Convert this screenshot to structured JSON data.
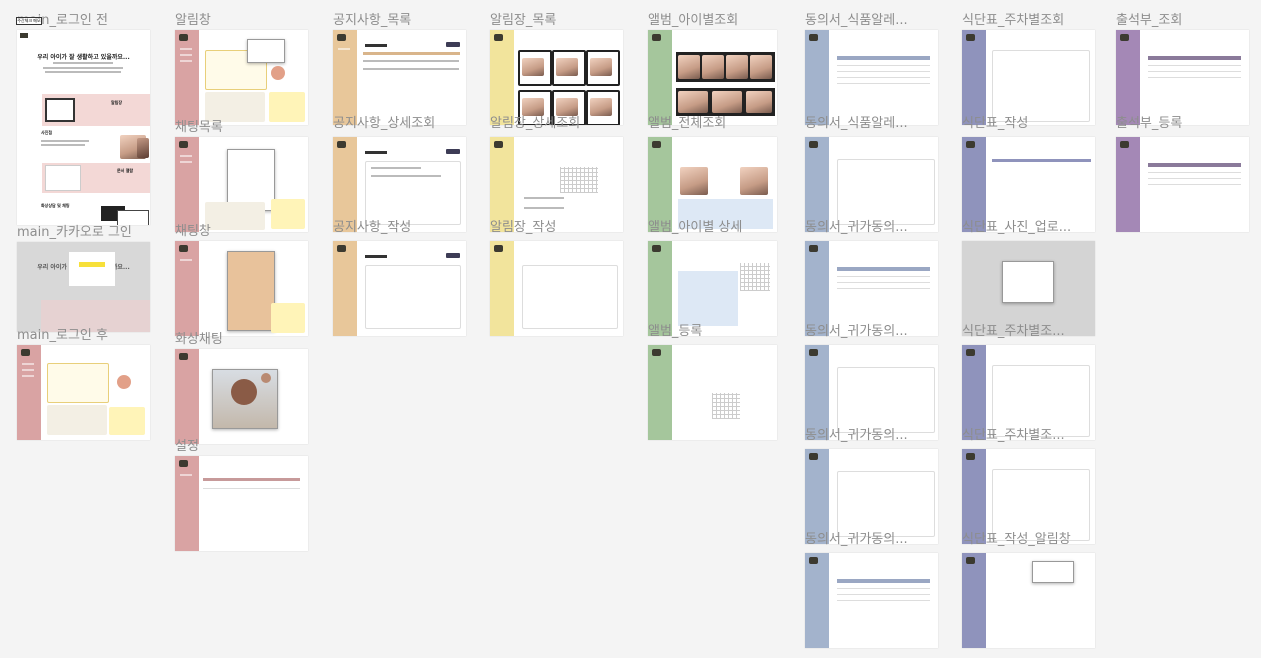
{
  "labels": {
    "c0": [
      "main_로그인 전",
      "main_카카오로 그인",
      "main_로그인 후"
    ],
    "c1": [
      "알림창",
      "채팅목록",
      "채팅창",
      "화상채팅",
      "설정"
    ],
    "c2": [
      "공지사항_목록",
      "공지사항_상세조회",
      "공지사항_작성"
    ],
    "c3": [
      "알림장_목록",
      "알림장_상세조회",
      "알림장_작성"
    ],
    "c4": [
      "앨범_아이별조회",
      "앨범_전체조회",
      "앨범_아이별 상세",
      "앨범_등록"
    ],
    "c5": [
      "동의서_식품알레...",
      "동의서_식품알레...",
      "동의서_귀가동의...",
      "동의서_귀가동의...",
      "동의서_귀가동의...",
      "동의서_귀가동의..."
    ],
    "c6": [
      "식단표_주차별조회",
      "식단표_작성",
      "식단표_사진_업로...",
      "식단표_주차별조...",
      "식단표_주차별조...",
      "식단표_작성_알림창"
    ],
    "c7": [
      "출석부_조회",
      "출석부_등록"
    ]
  },
  "sticky_note": "주간체크 메모",
  "main_page": {
    "headline": "우리 아이가 잘 생활하고 있을까요...",
    "features": [
      "알림장",
      "사진첩",
      "문서 열람",
      "화상상담 및 채팅"
    ],
    "kakao_headline": "우리 아이가 잘 생활하고 있을까요..."
  },
  "colors": {
    "main": "#d9a3a3",
    "notify": "#d9a3a3",
    "notice": "#e8c79a",
    "diary": "#f2e49c",
    "album": "#a5c69c",
    "consent": "#a3b3cc",
    "meal": "#8f93bc",
    "attendance": "#a488b6"
  }
}
